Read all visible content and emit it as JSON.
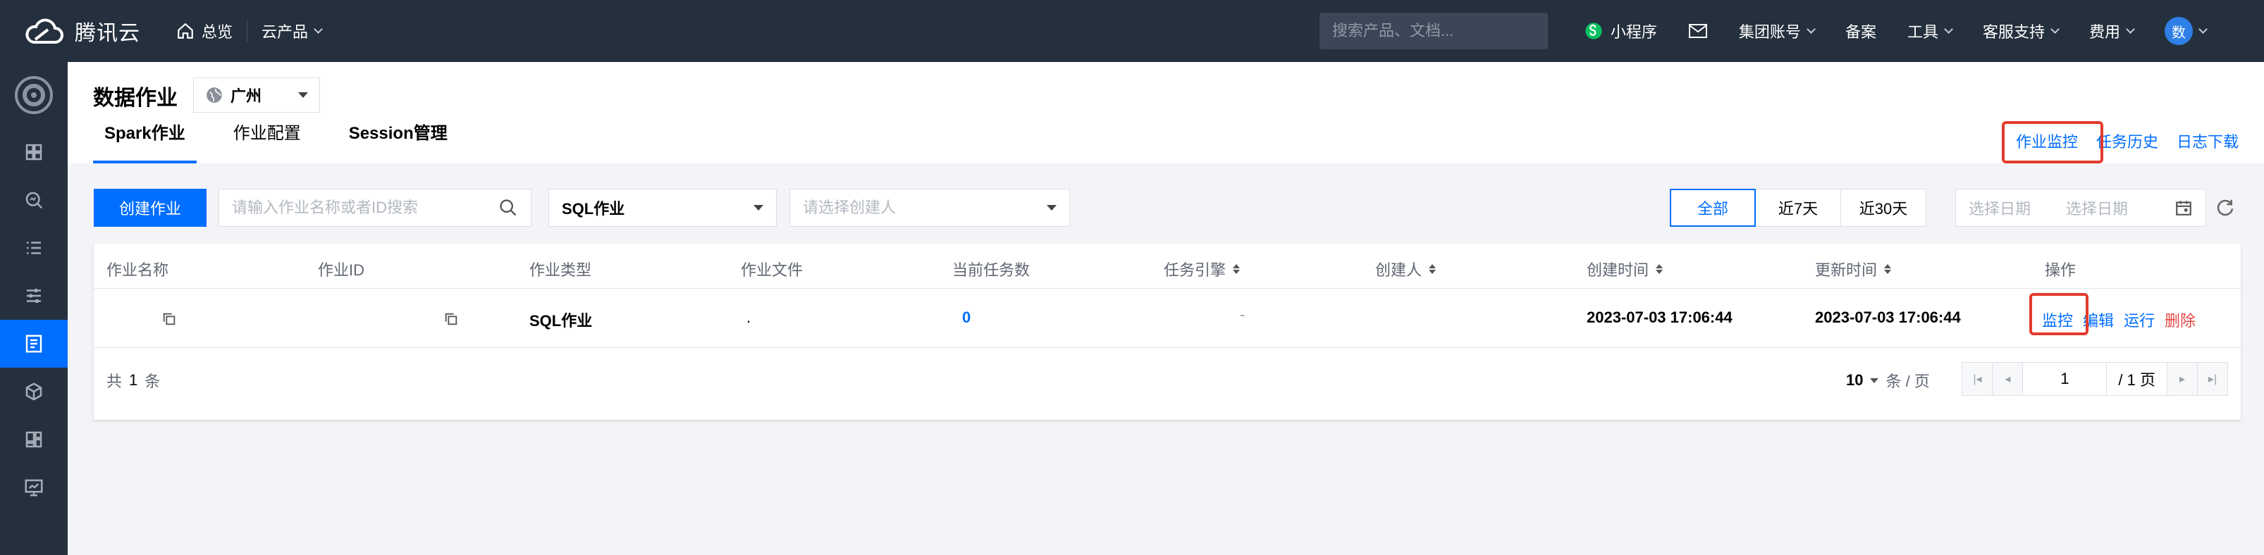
{
  "topbar": {
    "brand": "腾讯云",
    "nav": [
      {
        "label": "总览"
      },
      {
        "label": "云产品"
      }
    ],
    "search_placeholder": "搜索产品、文档...",
    "right": [
      {
        "label": "小程序"
      },
      {
        "label": ""
      },
      {
        "label": "集团账号"
      },
      {
        "label": "备案"
      },
      {
        "label": "工具"
      },
      {
        "label": "客服支持"
      },
      {
        "label": "费用"
      }
    ],
    "avatar": "数"
  },
  "page": {
    "title": "数据作业",
    "region": "广州",
    "tabs": [
      "Spark作业",
      "作业配置",
      "Session管理"
    ],
    "links": [
      "作业监控",
      "任务历史",
      "日志下载"
    ]
  },
  "toolbar": {
    "create_label": "创建作业",
    "search_placeholder": "请输入作业名称或者ID搜索",
    "type_value": "SQL作业",
    "creator_placeholder": "请选择创建人",
    "ranges": [
      "全部",
      "近7天",
      "近30天"
    ],
    "date_start_placeholder": "选择日期",
    "date_end_placeholder": "选择日期"
  },
  "table": {
    "columns": [
      "作业名称",
      "作业ID",
      "作业类型",
      "作业文件",
      "当前任务数",
      "任务引擎",
      "创建人",
      "创建时间",
      "更新时间",
      "操作"
    ],
    "rows": [
      {
        "type": "SQL作业",
        "file": ".",
        "tasks": "0",
        "engine": "-",
        "created": "2023-07-03 17:06:44",
        "updated": "2023-07-03 17:06:44",
        "ops": [
          "监控",
          "编辑",
          "运行",
          "删除"
        ]
      }
    ],
    "total_prefix": "共",
    "total_count": "1",
    "total_suffix": "条",
    "page_size": "10",
    "page_size_unit": "条 / 页",
    "current_page": "1",
    "total_pages": "/ 1 页"
  },
  "colors": {
    "accent": "#006eff",
    "danger": "#e54545",
    "highlight": "#e43a2c",
    "nav_bg": "#25303e"
  }
}
